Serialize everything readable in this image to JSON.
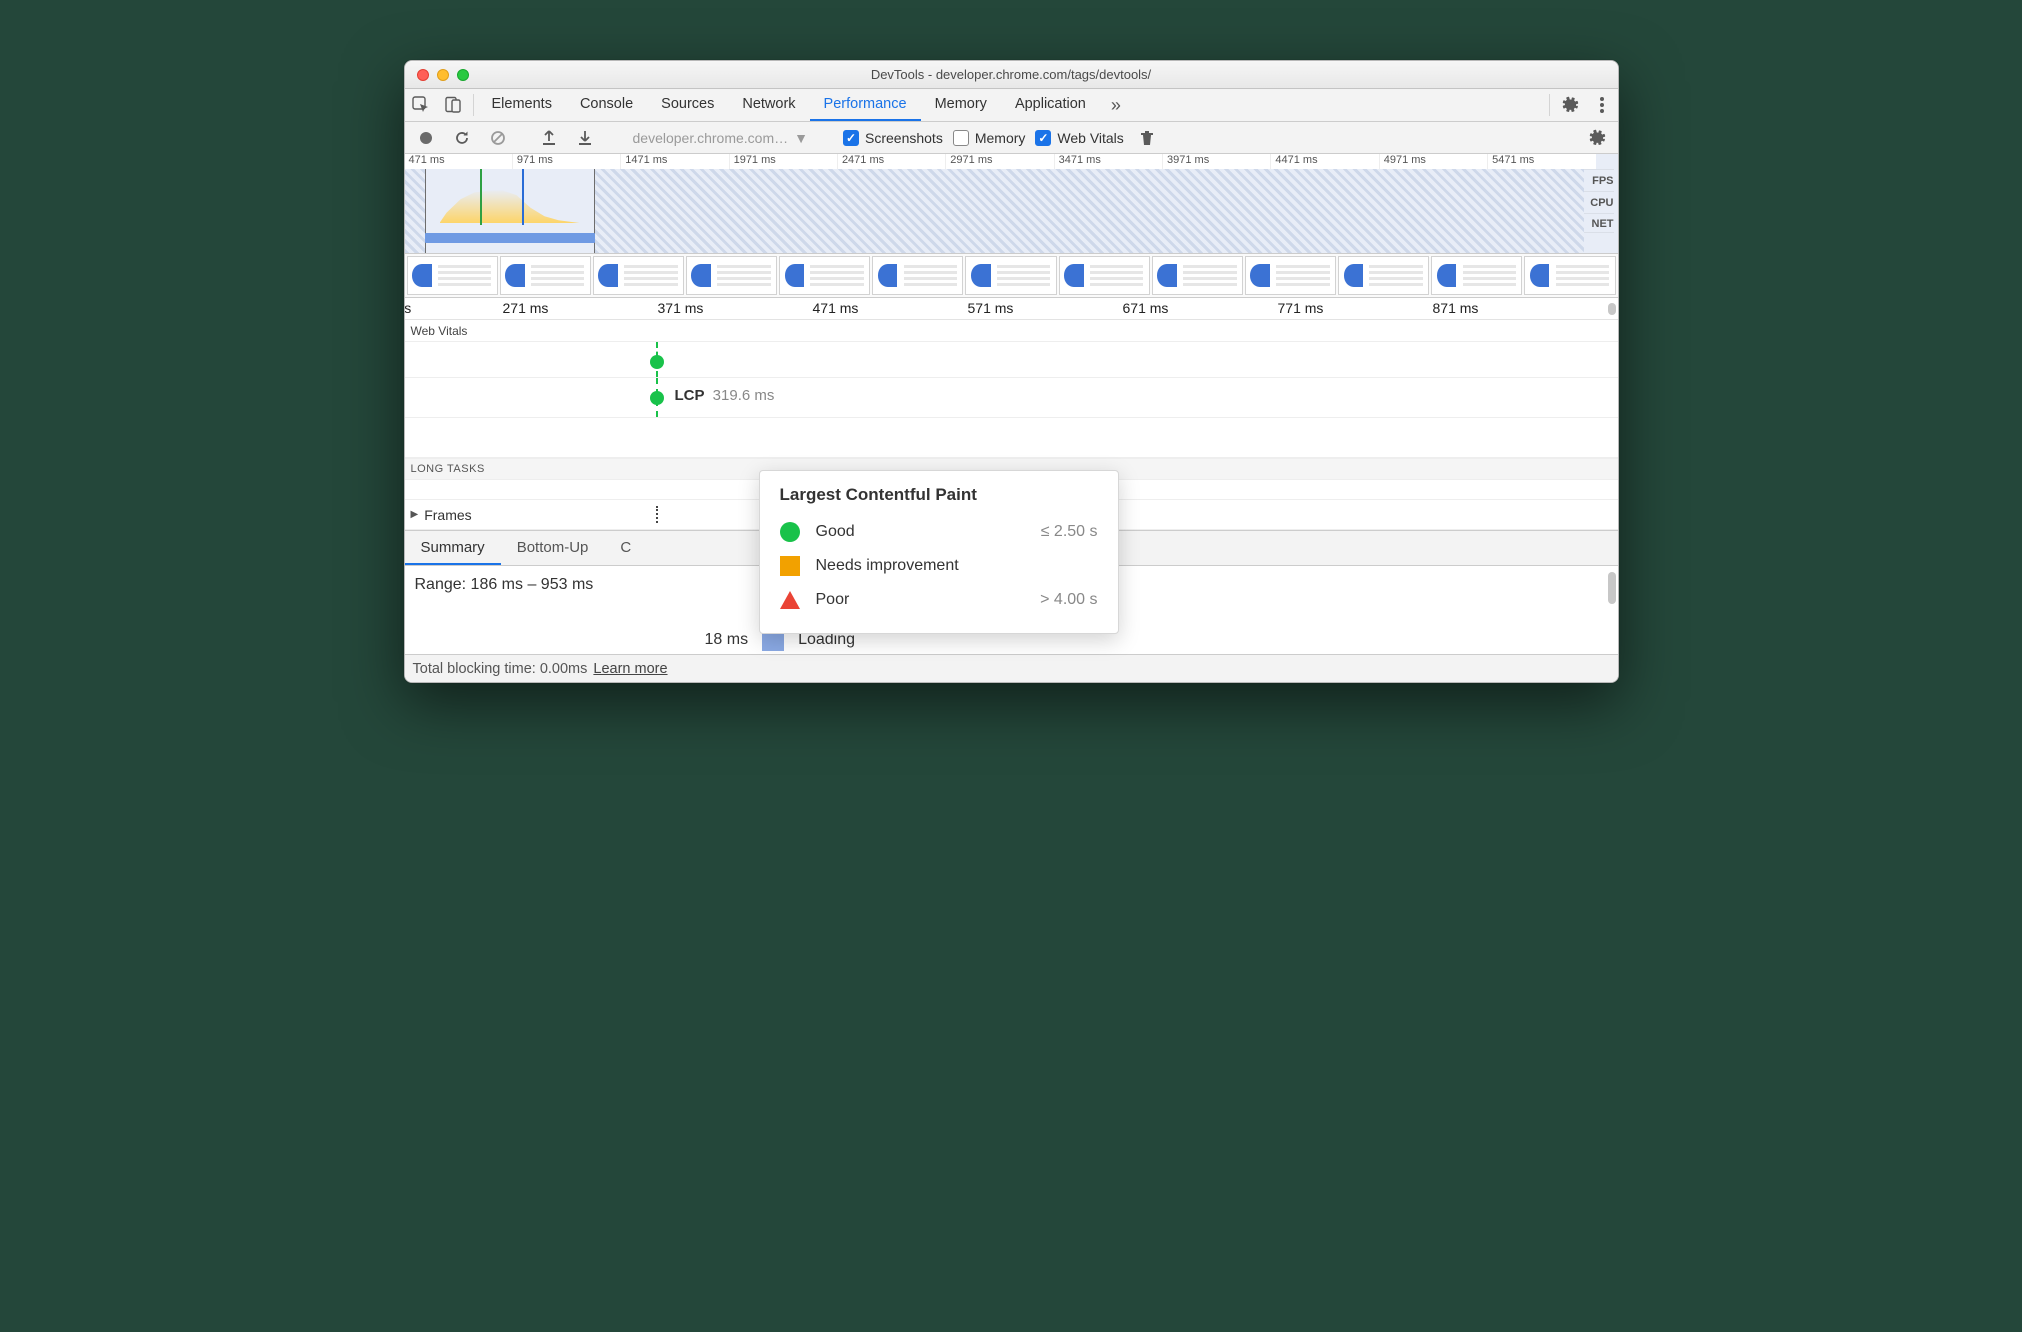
{
  "window": {
    "title": "DevTools - developer.chrome.com/tags/devtools/"
  },
  "tabs": {
    "elements": "Elements",
    "console": "Console",
    "sources": "Sources",
    "network": "Network",
    "performance": "Performance",
    "memory": "Memory",
    "application": "Application"
  },
  "toolbar": {
    "recording_select": "developer.chrome.com…",
    "screenshots_label": "Screenshots",
    "memory_label": "Memory",
    "webvitals_label": "Web Vitals"
  },
  "overview": {
    "ticks": [
      "471 ms",
      "971 ms",
      "1471 ms",
      "1971 ms",
      "2471 ms",
      "2971 ms",
      "3471 ms",
      "3971 ms",
      "4471 ms",
      "4971 ms",
      "5471 ms"
    ],
    "rows": [
      "FPS",
      "CPU",
      "NET"
    ]
  },
  "flame_ticks": [
    "ns",
    "271 ms",
    "371 ms",
    "471 ms",
    "571 ms",
    "671 ms",
    "771 ms",
    "871 ms"
  ],
  "webvitals": {
    "title": "Web Vitals",
    "lcp_label": "LCP",
    "lcp_value": "319.6 ms",
    "long_tasks_label": "LONG TASKS",
    "frames_label": "Frames"
  },
  "tooltip": {
    "title": "Largest Contentful Paint",
    "good": "Good",
    "good_thr": "≤ 2.50 s",
    "ni": "Needs improvement",
    "poor": "Poor",
    "poor_thr": "> 4.00 s"
  },
  "bottom_tabs": {
    "summary": "Summary",
    "bottomup": "Bottom-Up",
    "calltree": "C"
  },
  "summary": {
    "range": "Range: 186 ms – 953 ms",
    "loading_ms": "18 ms",
    "loading_label": "Loading"
  },
  "status": {
    "tbt": "Total blocking time: 0.00ms",
    "learn": "Learn more"
  }
}
